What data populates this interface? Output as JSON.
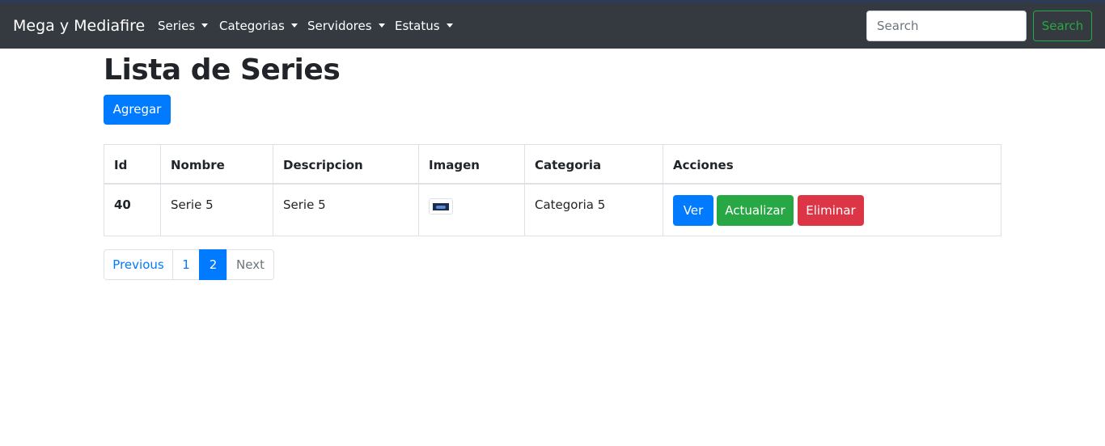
{
  "navbar": {
    "brand": "Mega y Mediafire",
    "items": [
      {
        "label": "Series"
      },
      {
        "label": "Categorias"
      },
      {
        "label": "Servidores"
      },
      {
        "label": "Estatus"
      }
    ],
    "search_placeholder": "Search",
    "search_button": "Search"
  },
  "page": {
    "title": "Lista de Series",
    "add_button": "Agregar"
  },
  "table": {
    "headers": [
      "Id",
      "Nombre",
      "Descripcion",
      "Imagen",
      "Categoria",
      "Acciones"
    ],
    "rows": [
      {
        "id": "40",
        "nombre": "Serie 5",
        "descripcion": "Serie 5",
        "categoria": "Categoria 5",
        "actions": [
          "Ver",
          "Actualizar",
          "Eliminar"
        ]
      }
    ]
  },
  "pagination": {
    "previous": "Previous",
    "pages": [
      "1",
      "2"
    ],
    "active_page": "2",
    "next": "Next"
  },
  "colors": {
    "navbar": "#343a40",
    "primary": "#007bff",
    "success": "#28a745",
    "danger": "#dc3545"
  }
}
